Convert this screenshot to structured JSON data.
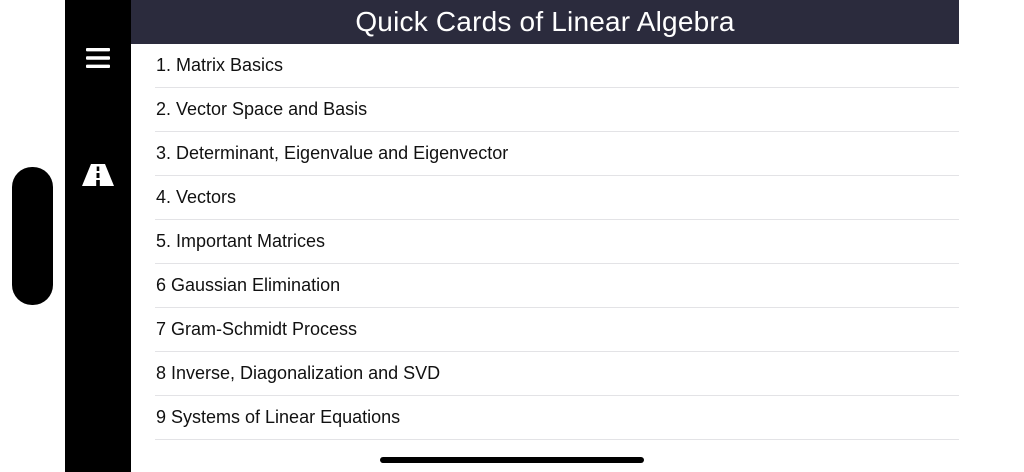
{
  "app": {
    "title": "Quick Cards of Linear Algebra"
  },
  "rail": {
    "menu_icon": "hamburger-menu-icon",
    "road_icon": "road-icon"
  },
  "list": {
    "items": [
      {
        "label": "1.  Matrix Basics"
      },
      {
        "label": "2.  Vector Space and Basis"
      },
      {
        "label": "3.  Determinant, Eigenvalue and Eigenvector"
      },
      {
        "label": "4.  Vectors"
      },
      {
        "label": "5.  Important Matrices"
      },
      {
        "label": "6  Gaussian Elimination"
      },
      {
        "label": "7  Gram-Schmidt Process"
      },
      {
        "label": "8  Inverse, Diagonalization and SVD"
      },
      {
        "label": "9  Systems of Linear Equations"
      }
    ]
  },
  "colors": {
    "header_bg": "#2b2b3d",
    "rail_bg": "#000000",
    "divider": "#e3e3e6"
  }
}
